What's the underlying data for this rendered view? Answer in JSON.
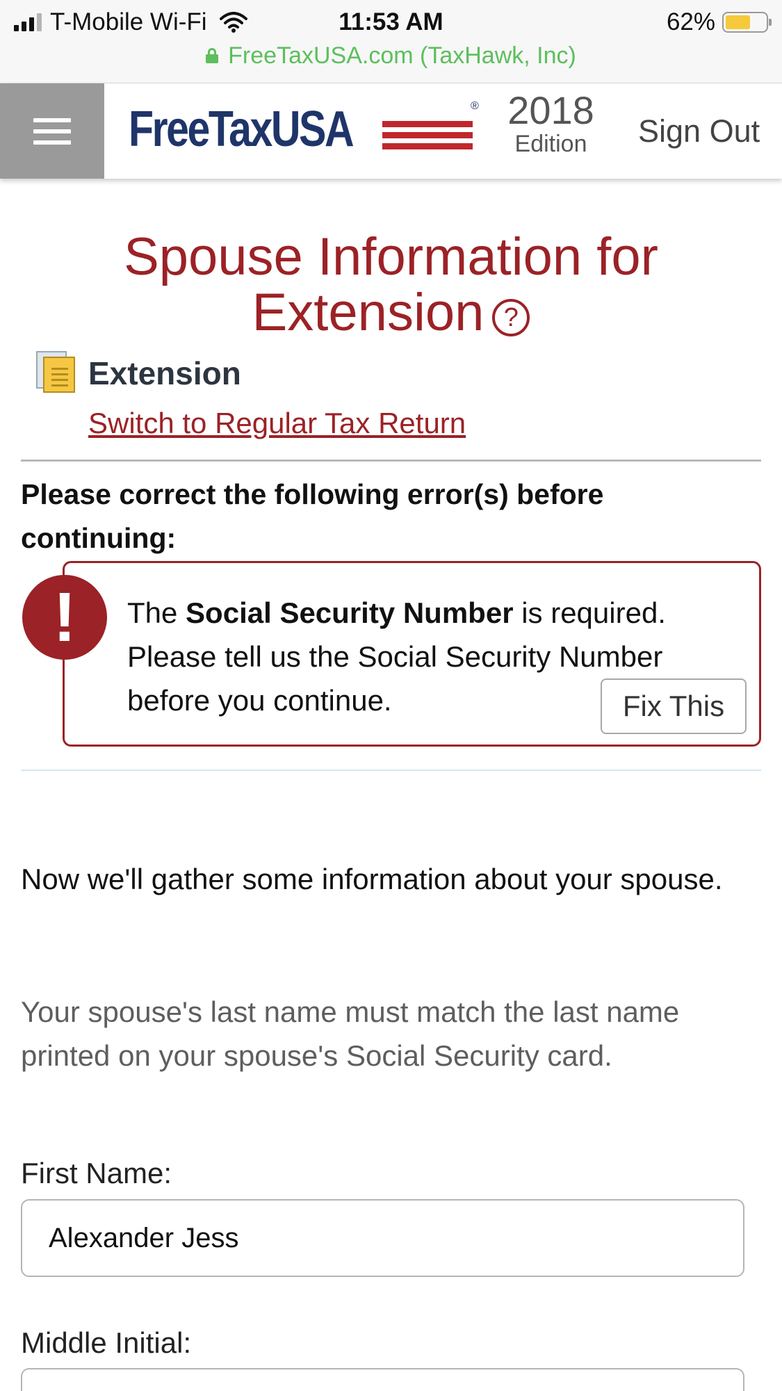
{
  "status_bar": {
    "carrier": "T-Mobile Wi-Fi",
    "time": "11:53 AM",
    "battery": "62%",
    "battery_level": 0.62,
    "url": "FreeTaxUSA.com (TaxHawk, Inc)"
  },
  "header": {
    "logo": "FreeTaxUSA",
    "edition_year": "2018",
    "edition_label": "Edition",
    "sign_out": "Sign Out"
  },
  "page": {
    "title": "Spouse Information for Extension",
    "help_symbol": "?",
    "section_label": "Extension",
    "switch_link": "Switch to Regular Tax Return"
  },
  "errors": {
    "heading": "Please correct the following error(s) before continuing:",
    "icon_symbol": "!",
    "message_prefix": "The ",
    "message_bold": "Social Security Number",
    "message_suffix": " is required. Please tell us the Social Security Number before you continue.",
    "fix_button": "Fix This"
  },
  "content": {
    "intro": "Now we'll gather some information about your spouse.",
    "note": "Your spouse's last name must match the last name printed on your spouse's Social Security card."
  },
  "form": {
    "first_name_label": "First Name:",
    "first_name_value": "Alexander Jess",
    "middle_initial_label": "Middle Initial:",
    "middle_initial_value": ""
  },
  "colors": {
    "brand_red": "#9b2226",
    "brand_navy": "#1f3569",
    "url_green": "#5cbf5c",
    "menu_gray": "#9a9a9a"
  }
}
